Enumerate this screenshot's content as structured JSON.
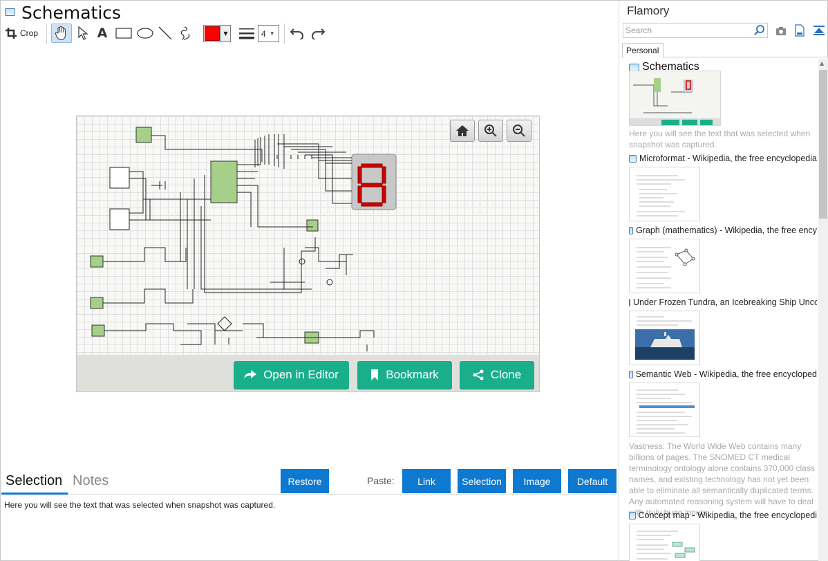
{
  "window": {
    "title": "Schematics"
  },
  "toolbar": {
    "crop_label": "Crop",
    "line_width_value": "4",
    "stroke_color": "#ff0000"
  },
  "viewer": {
    "buttons": {
      "open_editor": "Open in Editor",
      "bookmark": "Bookmark",
      "clone": "Clone"
    },
    "accent": "#1aaf8b"
  },
  "bottom": {
    "tabs": [
      "Selection",
      "Notes"
    ],
    "restore_label": "Restore",
    "paste_label": "Paste:",
    "paste_buttons": [
      "Link",
      "Selection",
      "Image",
      "Default"
    ],
    "selection_text": "Here you will see the text that was selected when snapshot was captured.",
    "accent": "#0d79d1"
  },
  "sidebar": {
    "title": "Flamory",
    "search_placeholder": "Search",
    "tab": "Personal",
    "entries": [
      {
        "title": "Schematics",
        "text": "Here you will see the text that was selected when snapshot was captured."
      },
      {
        "title": "Microformat - Wikipedia, the free encyclopedia",
        "text": ""
      },
      {
        "title": "Graph (mathematics) - Wikipedia, the free ency",
        "text": ""
      },
      {
        "title": "Under Frozen Tundra, an Icebreaking Ship Unco",
        "text": ""
      },
      {
        "title": "Semantic Web - Wikipedia, the free encycloped",
        "text": "Vastness: The World Wide Web contains many billions of pages. The SNOMED CT medical terminology ontology alone contains 370,000 class names, and existing technology has not yet been able to eliminate all semantically duplicated terms. Any automated reasoning system will have to deal with truly huge inputs."
      },
      {
        "title": "Concept map - Wikipedia, the free encyclopedi",
        "text": ""
      }
    ]
  }
}
